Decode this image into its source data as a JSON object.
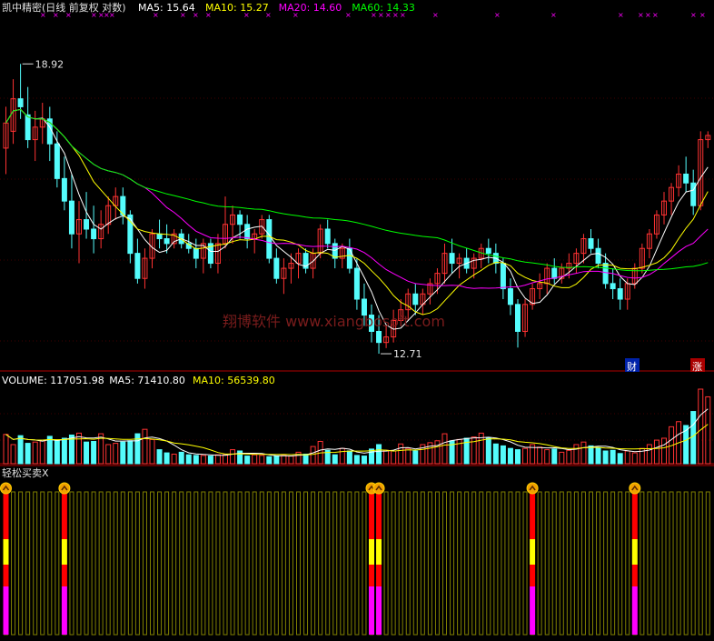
{
  "price_panel": {
    "title": "凯中精密(日线 前复权 对数)",
    "ma_labels": [
      {
        "text": "MA5: 15.64",
        "color": "#FFFFFF"
      },
      {
        "text": "MA10: 15.27",
        "color": "#FFFF00"
      },
      {
        "text": "MA20: 14.60",
        "color": "#FF00FF"
      },
      {
        "text": "MA60: 14.33",
        "color": "#00FF00"
      }
    ],
    "high_marker": "18.92",
    "low_marker": "12.71",
    "badge_cai": "财",
    "badge_zhang": "涨",
    "watermark": "翔博软件 www.xiangbosoft.com"
  },
  "volume_panel": {
    "labels": [
      {
        "text": "VOLUME: 117051.98",
        "color": "#FFFFFF"
      },
      {
        "text": "MA5: 71410.80",
        "color": "#FFFFFF"
      },
      {
        "text": "MA10: 56539.80",
        "color": "#FFFF00"
      }
    ]
  },
  "indicator_panel": {
    "title": "轻松买卖X"
  },
  "colors": {
    "up": "#FF3232",
    "down": "#54FCFC",
    "ma5": "#FFFFFF",
    "ma10": "#FFFF00",
    "ma20": "#FF00FF",
    "ma60": "#00FF00",
    "grid": "#800000",
    "signal_bar": "#808000"
  },
  "chart_data": [
    {
      "type": "candlestick",
      "panel": "price",
      "scale": "log",
      "ylim": [
        12.3,
        20.2
      ],
      "ohlc": [
        [
          16.8,
          17.8,
          16.2,
          17.4
        ],
        [
          17.2,
          18.5,
          16.9,
          18.0
        ],
        [
          18.0,
          18.9,
          17.5,
          17.8
        ],
        [
          17.6,
          18.3,
          16.8,
          17.0
        ],
        [
          17.0,
          17.7,
          16.5,
          17.3
        ],
        [
          17.3,
          17.9,
          16.9,
          17.5
        ],
        [
          17.5,
          17.8,
          16.5,
          16.9
        ],
        [
          16.9,
          17.2,
          15.9,
          16.1
        ],
        [
          16.1,
          16.6,
          15.4,
          15.6
        ],
        [
          15.6,
          16.2,
          14.6,
          14.9
        ],
        [
          14.9,
          15.6,
          14.3,
          15.2
        ],
        [
          15.2,
          15.8,
          14.8,
          15.0
        ],
        [
          15.0,
          15.5,
          14.5,
          14.8
        ],
        [
          14.8,
          15.4,
          14.6,
          15.1
        ],
        [
          15.1,
          15.7,
          14.9,
          15.5
        ],
        [
          15.5,
          15.9,
          15.2,
          15.7
        ],
        [
          15.7,
          15.9,
          15.1,
          15.3
        ],
        [
          15.3,
          15.4,
          14.3,
          14.5
        ],
        [
          14.5,
          14.8,
          13.9,
          14.0
        ],
        [
          14.0,
          14.6,
          13.8,
          14.4
        ],
        [
          14.4,
          15.0,
          14.2,
          14.9
        ],
        [
          14.9,
          15.2,
          14.6,
          14.8
        ],
        [
          14.8,
          15.1,
          14.5,
          14.7
        ],
        [
          14.7,
          15.0,
          14.6,
          14.9
        ],
        [
          14.9,
          15.0,
          14.6,
          14.7
        ],
        [
          14.7,
          14.9,
          14.5,
          14.6
        ],
        [
          14.6,
          14.8,
          14.2,
          14.4
        ],
        [
          14.4,
          14.8,
          14.1,
          14.7
        ],
        [
          14.7,
          14.8,
          14.2,
          14.3
        ],
        [
          14.3,
          14.9,
          14.1,
          14.7
        ],
        [
          14.7,
          15.7,
          14.6,
          15.1
        ],
        [
          15.1,
          15.5,
          14.7,
          15.3
        ],
        [
          15.3,
          15.4,
          14.8,
          15.1
        ],
        [
          15.1,
          15.3,
          14.6,
          14.8
        ],
        [
          14.8,
          15.0,
          14.5,
          14.9
        ],
        [
          14.9,
          15.3,
          14.8,
          15.2
        ],
        [
          15.2,
          15.3,
          14.3,
          14.4
        ],
        [
          14.4,
          14.6,
          13.9,
          14.0
        ],
        [
          14.0,
          14.4,
          13.7,
          14.2
        ],
        [
          14.2,
          14.5,
          13.9,
          14.3
        ],
        [
          14.3,
          14.6,
          14.0,
          14.5
        ],
        [
          14.5,
          14.6,
          14.1,
          14.2
        ],
        [
          14.2,
          14.6,
          14.0,
          14.5
        ],
        [
          14.5,
          15.1,
          14.4,
          15.0
        ],
        [
          15.0,
          15.2,
          14.6,
          14.7
        ],
        [
          14.7,
          14.8,
          14.2,
          14.4
        ],
        [
          14.4,
          14.7,
          14.2,
          14.6
        ],
        [
          14.6,
          14.8,
          14.1,
          14.2
        ],
        [
          14.2,
          14.4,
          13.4,
          13.6
        ],
        [
          13.6,
          13.9,
          13.1,
          13.3
        ],
        [
          13.3,
          13.5,
          12.8,
          13.0
        ],
        [
          13.0,
          13.3,
          12.6,
          12.8
        ],
        [
          12.8,
          13.1,
          12.7,
          12.9
        ],
        [
          12.9,
          13.4,
          12.8,
          13.2
        ],
        [
          13.2,
          13.6,
          13.1,
          13.4
        ],
        [
          13.4,
          13.8,
          13.2,
          13.7
        ],
        [
          13.7,
          13.9,
          13.3,
          13.5
        ],
        [
          13.5,
          13.8,
          13.3,
          13.7
        ],
        [
          13.7,
          14.0,
          13.5,
          13.9
        ],
        [
          13.9,
          14.2,
          13.7,
          14.1
        ],
        [
          14.1,
          14.7,
          13.9,
          14.5
        ],
        [
          14.5,
          14.8,
          14.1,
          14.3
        ],
        [
          14.3,
          14.5,
          14.0,
          14.4
        ],
        [
          14.4,
          14.6,
          14.1,
          14.2
        ],
        [
          14.2,
          14.5,
          14.0,
          14.4
        ],
        [
          14.4,
          14.7,
          14.2,
          14.6
        ],
        [
          14.6,
          14.8,
          14.3,
          14.5
        ],
        [
          14.5,
          14.7,
          14.1,
          14.3
        ],
        [
          14.3,
          14.4,
          13.6,
          13.8
        ],
        [
          13.8,
          14.0,
          13.3,
          13.5
        ],
        [
          13.5,
          13.6,
          12.71,
          13.0
        ],
        [
          13.0,
          13.6,
          12.9,
          13.5
        ],
        [
          13.5,
          13.9,
          13.4,
          13.8
        ],
        [
          13.8,
          14.1,
          13.6,
          13.9
        ],
        [
          13.9,
          14.3,
          13.7,
          14.2
        ],
        [
          14.2,
          14.4,
          13.9,
          14.0
        ],
        [
          14.0,
          14.3,
          13.9,
          14.2
        ],
        [
          14.2,
          14.5,
          14.0,
          14.3
        ],
        [
          14.3,
          14.6,
          14.1,
          14.5
        ],
        [
          14.5,
          14.9,
          14.3,
          14.8
        ],
        [
          14.8,
          15.0,
          14.5,
          14.6
        ],
        [
          14.6,
          14.8,
          14.2,
          14.3
        ],
        [
          14.3,
          14.5,
          13.8,
          13.9
        ],
        [
          13.9,
          14.2,
          13.6,
          13.8
        ],
        [
          13.8,
          14.0,
          13.4,
          13.6
        ],
        [
          13.6,
          14.0,
          13.4,
          13.9
        ],
        [
          13.9,
          14.3,
          13.8,
          14.2
        ],
        [
          14.2,
          14.7,
          14.1,
          14.6
        ],
        [
          14.6,
          15.0,
          14.4,
          14.9
        ],
        [
          14.9,
          15.4,
          14.8,
          15.3
        ],
        [
          15.3,
          15.8,
          15.1,
          15.6
        ],
        [
          15.6,
          16.0,
          15.3,
          15.9
        ],
        [
          15.9,
          16.4,
          15.7,
          16.2
        ],
        [
          16.2,
          16.6,
          15.8,
          16.0
        ],
        [
          16.0,
          16.3,
          15.3,
          15.5
        ],
        [
          15.5,
          17.2,
          15.4,
          17.0
        ],
        [
          17.0,
          17.2,
          16.8,
          17.1
        ]
      ]
    },
    {
      "type": "bar",
      "panel": "volume",
      "values": [
        46000,
        30000,
        44000,
        32000,
        34000,
        37000,
        43000,
        36000,
        40000,
        45000,
        48000,
        34000,
        35000,
        47000,
        30000,
        32000,
        34000,
        36000,
        47000,
        54000,
        38000,
        22000,
        17000,
        15000,
        18000,
        14000,
        13000,
        13000,
        12000,
        14000,
        14000,
        22000,
        20000,
        12000,
        14000,
        13000,
        11000,
        12000,
        13000,
        12000,
        18000,
        15000,
        27000,
        35000,
        21000,
        14000,
        24000,
        20000,
        13000,
        12000,
        23000,
        30000,
        21000,
        20000,
        31000,
        24000,
        20000,
        30000,
        33000,
        36000,
        47000,
        36000,
        38000,
        40000,
        42000,
        48000,
        40000,
        31000,
        28000,
        24000,
        22000,
        24000,
        30000,
        26000,
        22000,
        23000,
        18000,
        21000,
        30000,
        34000,
        28000,
        25000,
        20000,
        21000,
        16000,
        20000,
        17000,
        24000,
        30000,
        37000,
        40000,
        58000,
        66000,
        60000,
        82000,
        117052,
        105000
      ],
      "ma5_last": 71410.8,
      "ma10_last": 56539.8
    }
  ]
}
